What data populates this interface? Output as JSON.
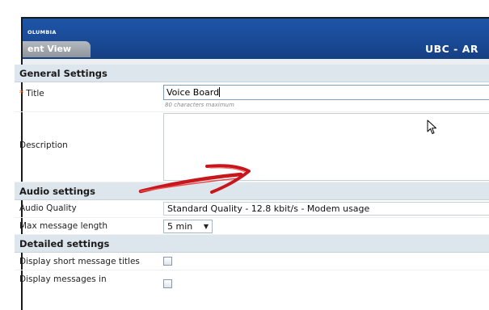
{
  "header": {
    "brand_text": "OLUMBIA",
    "view_tab": "ent View",
    "app_title": "UBC - AR"
  },
  "sections": {
    "general": "General Settings",
    "audio": "Audio settings",
    "detailed": "Detailed settings"
  },
  "fields": {
    "title": {
      "required_mark": "*",
      "label": "Title",
      "value": "Voice Board",
      "hint": "80 characters maximum"
    },
    "description": {
      "label": "Description",
      "value": ""
    },
    "audio_quality": {
      "label": "Audio Quality",
      "value": "Standard Quality - 12.8 kbit/s - Modem usage"
    },
    "max_length": {
      "label": "Max message length",
      "value": "5 min"
    },
    "short_titles": {
      "label": "Display short message titles",
      "checked": false
    },
    "display_messages": {
      "label": "Display messages in",
      "checked": false
    }
  },
  "annotations": {
    "cursor_icon": "mouse-pointer-icon",
    "arrow_icon": "red-arrow-annotation-icon",
    "arrow_color": "#c8161d"
  },
  "colors": {
    "banner": "#1a4a96",
    "section_bg": "#dde5ed",
    "required": "#e05a1a"
  }
}
